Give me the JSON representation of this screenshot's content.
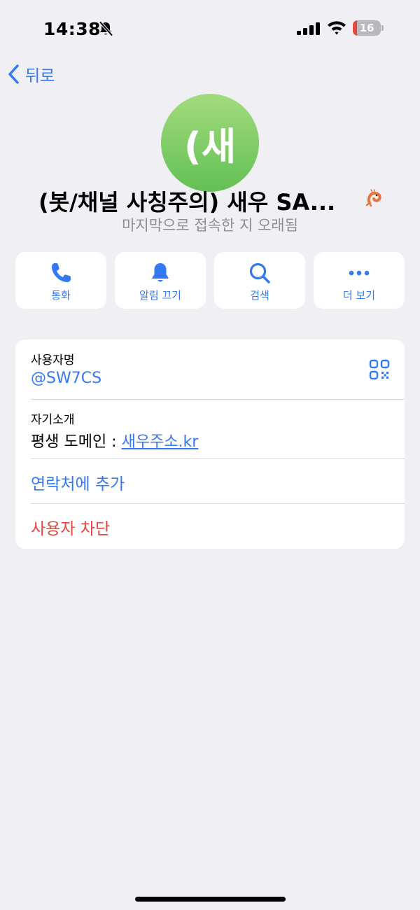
{
  "status_bar": {
    "time": "14:38",
    "battery_level": "16",
    "battery_fraction": 0.16,
    "battery_color": "#e64a3f"
  },
  "nav": {
    "back_label": "뒤로"
  },
  "profile": {
    "avatar_text": "(새",
    "name": "(봇/채널 사칭주의) 새우 SA...",
    "status": "마지막으로 접속한 지 오래됨"
  },
  "actions": [
    {
      "label": "통화",
      "icon": "phone-icon"
    },
    {
      "label": "알림 끄기",
      "icon": "bell-icon"
    },
    {
      "label": "검색",
      "icon": "search-icon"
    },
    {
      "label": "더 보기",
      "icon": "more-icon"
    }
  ],
  "info": {
    "username_label": "사용자명",
    "username": "@SW7CS",
    "bio_label": "자기소개",
    "bio_prefix": "평생 도메인 : ",
    "bio_link": "새우주소.kr",
    "add_contact": "연락처에 추가",
    "block_user": "사용자 차단"
  },
  "colors": {
    "accent": "#3478f6",
    "danger": "#e5463c",
    "background": "#efeff4"
  }
}
